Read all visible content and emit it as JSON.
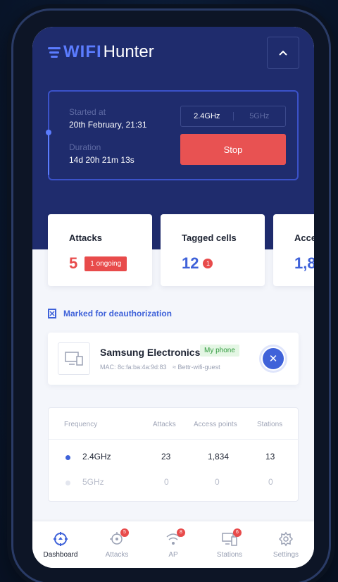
{
  "app": {
    "logo_part1": "WIFI",
    "logo_part2": "Hunter"
  },
  "session": {
    "started_label": "Started at",
    "started_value": "20th February, 21:31",
    "duration_label": "Duration",
    "duration_value": "14d  20h  21m  13s",
    "freq_options": [
      "2.4GHz",
      "5GHz"
    ],
    "freq_selected": "2.4GHz",
    "stop_label": "Stop"
  },
  "cards": [
    {
      "title": "Attacks",
      "value": "5",
      "badge": "1 ongoing"
    },
    {
      "title": "Tagged cells",
      "value": "12",
      "badge": "1"
    },
    {
      "title": "Acce",
      "value": "1,8"
    }
  ],
  "marked": {
    "label": "Marked for deauthorization"
  },
  "device": {
    "name": "Samsung Electronics...",
    "tag": "My phone",
    "mac": "MAC: 8c:fa:ba:4a:9d:83",
    "network": "Bettr-wifi-guest"
  },
  "table": {
    "headers": [
      "Frequency",
      "Attacks",
      "Access points",
      "Stations"
    ],
    "rows": [
      {
        "freq": "2.4GHz",
        "attacks": "23",
        "aps": "1,834",
        "stations": "13",
        "active": true
      },
      {
        "freq": "5GHz",
        "attacks": "0",
        "aps": "0",
        "stations": "0",
        "active": false
      }
    ]
  },
  "nav": [
    {
      "label": "Dashboard",
      "icon": "dashboard-icon",
      "active": true
    },
    {
      "label": "Attacks",
      "icon": "crosshair-icon",
      "badge": "5"
    },
    {
      "label": "AP",
      "icon": "wifi-icon",
      "badge": "8"
    },
    {
      "label": "Stations",
      "icon": "devices-icon",
      "badge": "6"
    },
    {
      "label": "Settings",
      "icon": "gear-icon"
    }
  ],
  "colors": {
    "navy": "#1f2c6d",
    "accent": "#3f62d9",
    "danger": "#e84b4b"
  }
}
